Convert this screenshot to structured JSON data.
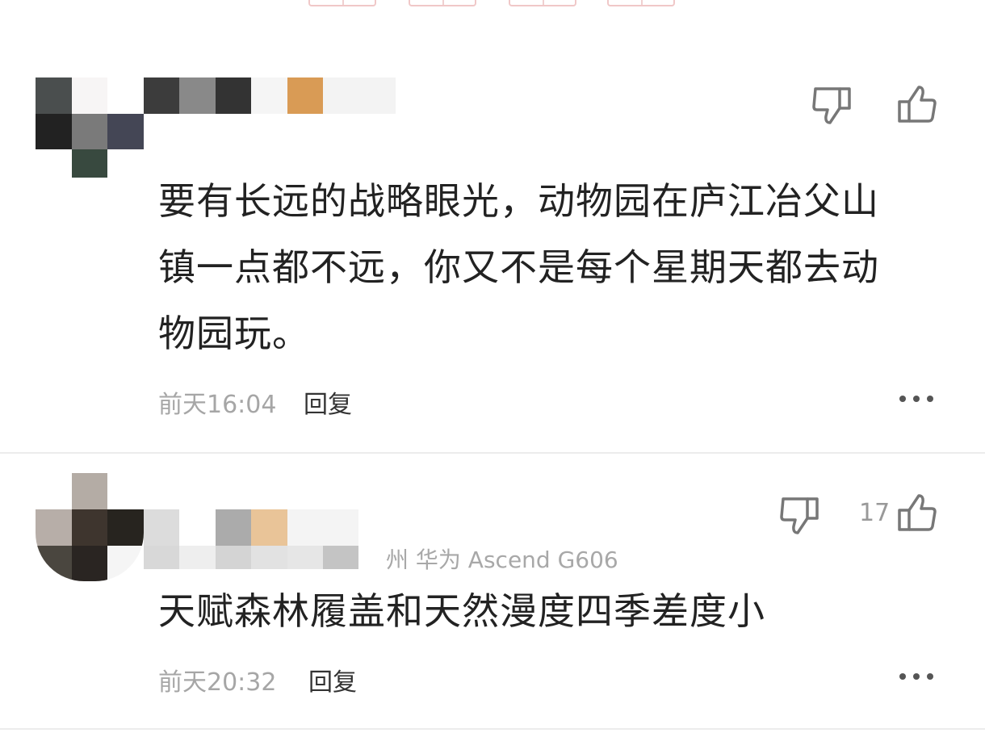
{
  "comments": [
    {
      "text": "要有长远的战略眼光，动物园在庐江冶父山镇一点都不远，你又不是每个星期天都去动物园玩。",
      "lines": [
        "要有长远的战略眼光，动物园在庐江冶父山",
        "镇一点都不远，你又不是每个星期天都去动",
        "物园玩。"
      ],
      "time": "前天16:04",
      "reply_label": "回复",
      "like_count": ""
    },
    {
      "text": "天赋森林履盖和天然漫度四季差度小",
      "lines": [
        "天赋森林履盖和天然漫度四季差度小"
      ],
      "time": "前天20:32",
      "reply_label": "回复",
      "like_count": "17",
      "device": "州  华为 Ascend G606"
    }
  ],
  "icons": {
    "dislike": "thumbs-down-icon",
    "like": "thumbs-up-icon",
    "more": "more-dots-icon"
  },
  "colors": {
    "text": "#222222",
    "meta": "#a6a6a6",
    "icon": "#777777",
    "divider": "#ececec"
  }
}
